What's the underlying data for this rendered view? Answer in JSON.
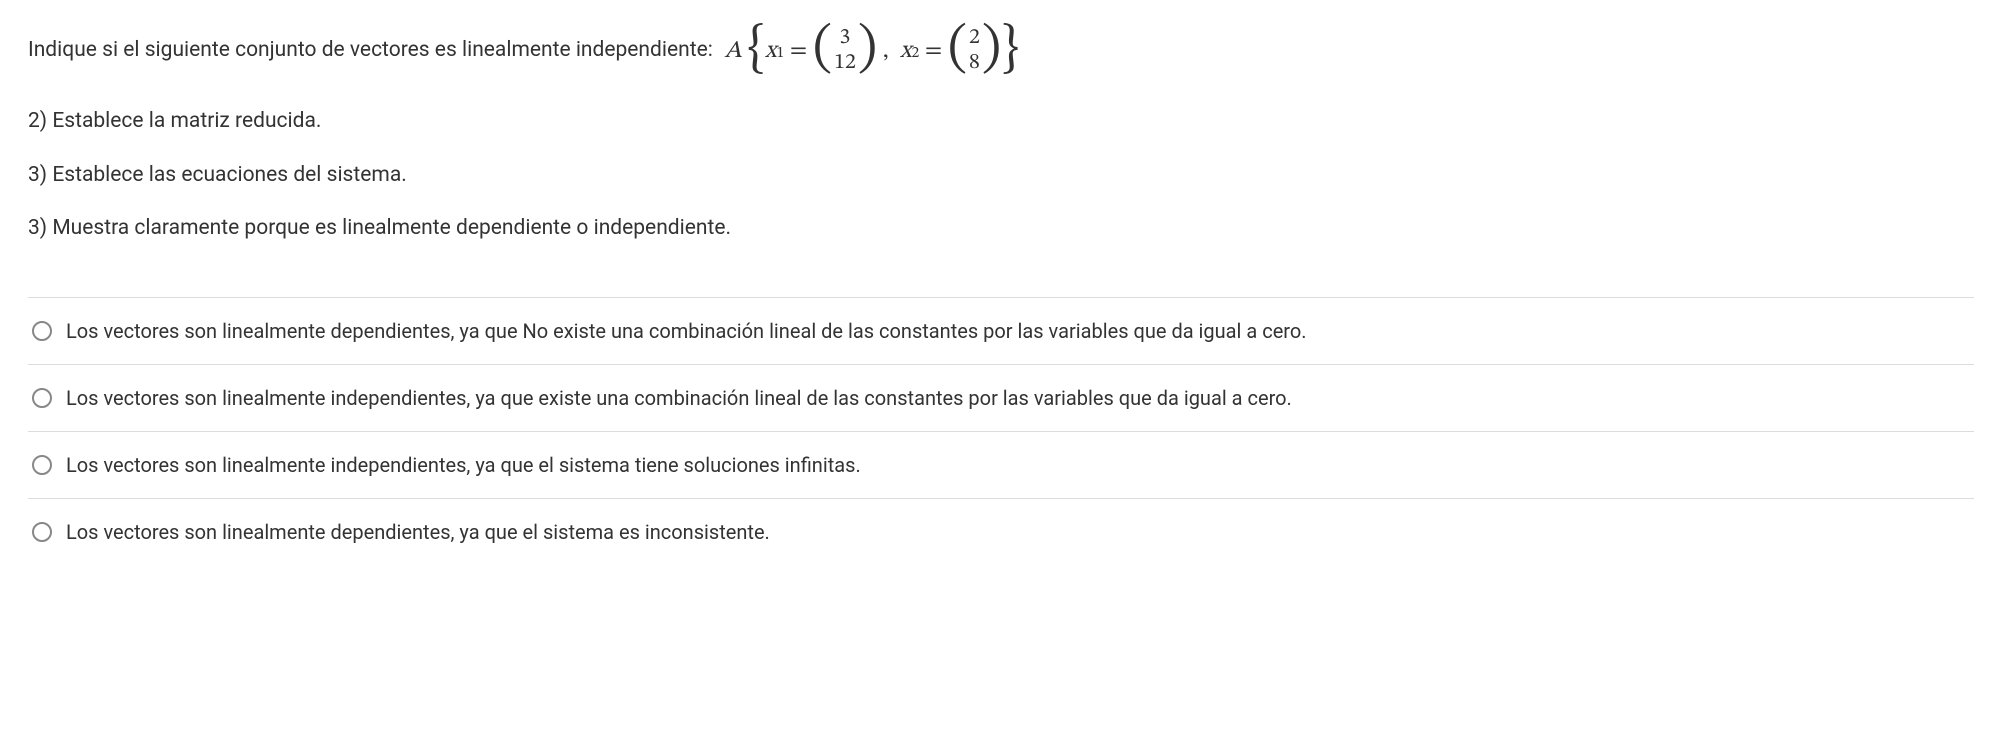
{
  "question": {
    "lead_text": "Indique si el siguiente conjunto de vectores es linealmente independiente:",
    "set_label": "A",
    "vec1_label": "x",
    "vec1_sub": "1",
    "vec1_top": "3",
    "vec1_bot": "12",
    "vec2_label": "x",
    "vec2_sub": "2",
    "vec2_top": "2",
    "vec2_bot": "8"
  },
  "subquestions": {
    "s1": "2) Establece la matriz reducida.",
    "s2": "3) Establece las ecuaciones del sistema.",
    "s3": "3) Muestra claramente porque es linealmente dependiente o independiente."
  },
  "options": {
    "o1": "Los vectores son linealmente dependientes, ya que No existe una combinación lineal de las constantes por las variables que da igual a cero.",
    "o2": "Los vectores son linealmente independientes, ya que existe una combinación lineal de las constantes por las variables que da igual a cero.",
    "o3": "Los vectores son linealmente independientes, ya que el sistema tiene soluciones infinitas.",
    "o4": "Los vectores son linealmente dependientes, ya que el sistema es inconsistente."
  }
}
